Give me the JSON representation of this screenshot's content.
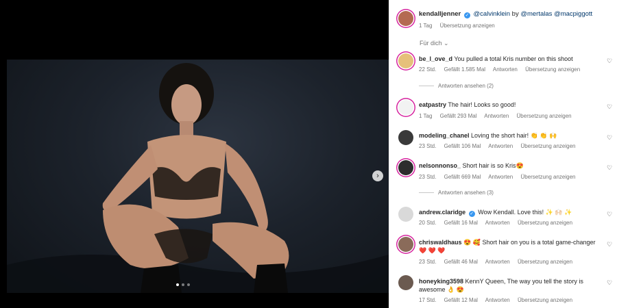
{
  "post": {
    "username": "kendalljenner",
    "mention_brand": "@calvinklein",
    "by_word": "by",
    "mention_1": "@mertalas",
    "mention_2": "@macpiggott",
    "time": "1 Tag",
    "translate": "Übersetzung anzeigen"
  },
  "fuer_dich": "Für dich",
  "comments": [
    {
      "user": "be_l_ove_d",
      "text": "You pulled a total Kris number on this shoot",
      "time": "22 Std.",
      "likes": "Gefällt 1.585 Mal",
      "reply": "Antworten",
      "translate": "Übersetzung anzeigen",
      "view_replies": "Antworten ansehen (2)"
    },
    {
      "user": "eatpastry",
      "text": "The hair! Looks so good!",
      "time": "1 Tag",
      "likes": "Gefällt 293 Mal",
      "reply": "Antworten",
      "translate": "Übersetzung anzeigen"
    },
    {
      "user": "modeling_chanel",
      "text": "Loving the short hair! 👏 👏 🙌",
      "time": "23 Std.",
      "likes": "Gefällt 106 Mal",
      "reply": "Antworten",
      "translate": "Übersetzung anzeigen"
    },
    {
      "user": "nelsonnonso_",
      "text": "Short hair is so Kris😍",
      "time": "23 Std.",
      "likes": "Gefällt 669 Mal",
      "reply": "Antworten",
      "translate": "Übersetzung anzeigen",
      "view_replies": "Antworten ansehen (3)"
    },
    {
      "user": "andrew.claridge",
      "text": "Wow Kendall. Love this! ✨ 🙌🏻 ✨",
      "time": "20 Std.",
      "likes": "Gefällt 16 Mal",
      "reply": "Antworten",
      "translate": "Übersetzung anzeigen"
    },
    {
      "user": "chriswaldhaus",
      "text": "😍 🥰 Short hair on you is a total game-changer ❤️ ❤️ ❤️",
      "time": "23 Std.",
      "likes": "Gefällt 46 Mal",
      "reply": "Antworten",
      "translate": "Übersetzung anzeigen"
    },
    {
      "user": "honeyking3598",
      "text": "KennY Queen, The way you tell the story is awesome 👌 😍",
      "time": "17 Std.",
      "likes": "Gefällt 12 Mal",
      "reply": "Antworten",
      "translate": "Übersetzung anzeigen"
    }
  ],
  "icons": {
    "heart": "heart-icon",
    "next": "chevron-right-icon",
    "verified": "verified-badge-icon"
  },
  "colors": {
    "verified": "#3897f0",
    "mention": "#00376b",
    "meta": "#737373"
  },
  "carousel": {
    "slides": 3,
    "active": 1
  }
}
